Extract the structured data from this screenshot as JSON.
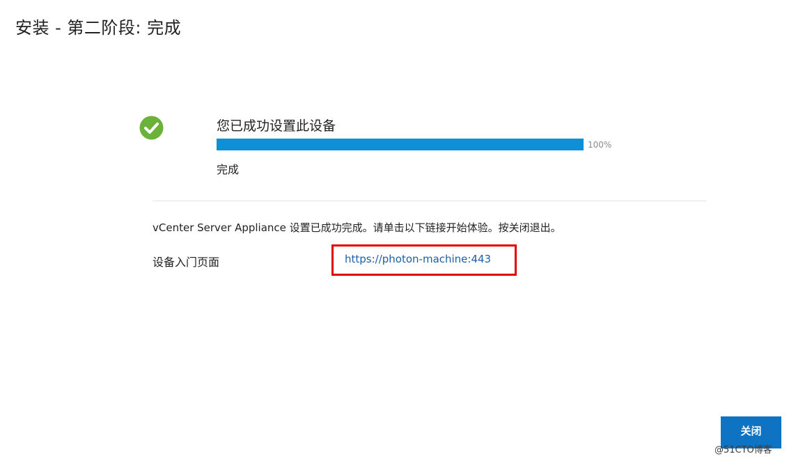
{
  "page": {
    "title": "安装 - 第二阶段: 完成"
  },
  "status": {
    "icon": "check-circle-icon",
    "heading": "您已成功设置此设备",
    "progress_fraction": 1.0,
    "progress_label": "100%",
    "state_text": "完成"
  },
  "message": "vCenter Server Appliance 设置已成功完成。请单击以下链接开始体验。按关闭退出。",
  "portal": {
    "label": "设备入门页面",
    "url": "https://photon-machine:443"
  },
  "footer": {
    "close_label": "关闭"
  },
  "watermark": "@51CTO博客",
  "colors": {
    "success_icon": "#6ab23a",
    "progress_fill": "#0f8fd6",
    "link": "#1b5fa6",
    "highlight_box": "#e00000",
    "primary_button": "#0f73c4"
  }
}
